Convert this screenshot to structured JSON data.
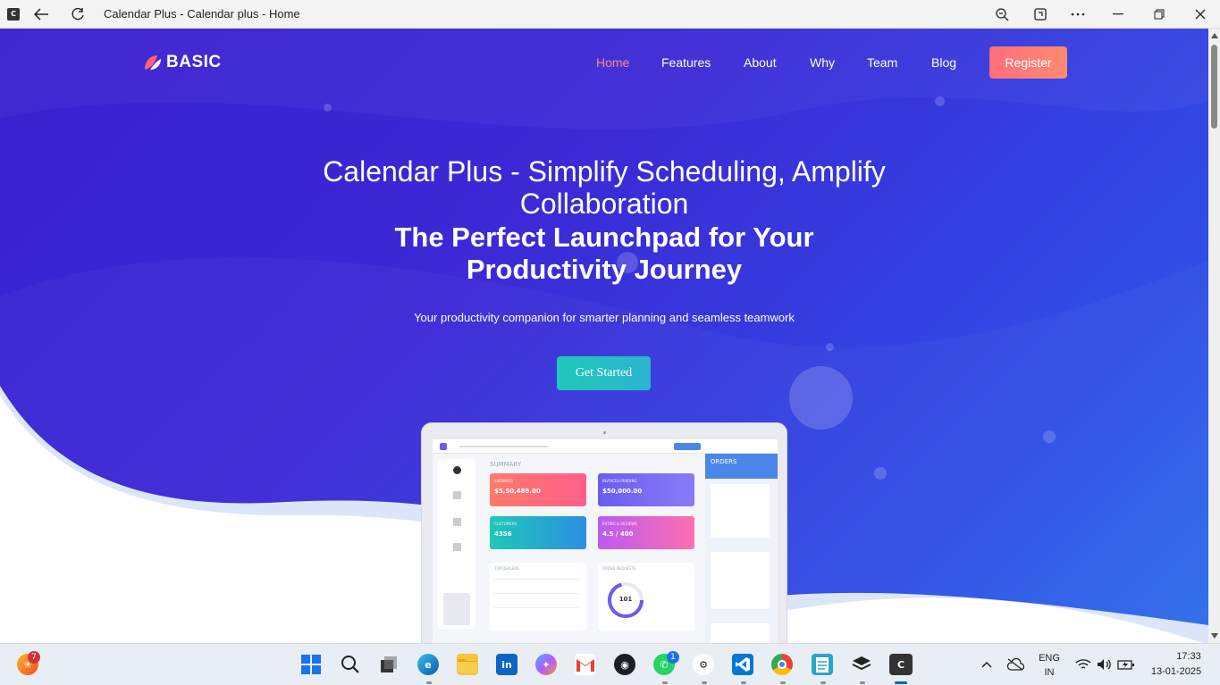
{
  "window": {
    "app_icon_letter": "C",
    "title": "Calendar Plus - Calendar plus - Home"
  },
  "site": {
    "logo_text": "BASIC",
    "nav": [
      {
        "label": "Home",
        "active": true
      },
      {
        "label": "Features",
        "active": false
      },
      {
        "label": "About",
        "active": false
      },
      {
        "label": "Why",
        "active": false
      },
      {
        "label": "Team",
        "active": false
      },
      {
        "label": "Blog",
        "active": false
      }
    ],
    "register_label": "Register"
  },
  "hero": {
    "title": "Calendar Plus - Simplify Scheduling, Amplify Collaboration",
    "headline": "The Perfect Launchpad for Your Productivity Journey",
    "subtitle": "Your productivity companion for smarter planning and seamless teamwork",
    "cta_label": "Get Started"
  },
  "mockup": {
    "summary_label": "SUMMARY",
    "cards": [
      {
        "label": "EARNINGS",
        "value": "$5,50,489.00",
        "color_from": "#ff7a6b",
        "color_to": "#ff5f8a"
      },
      {
        "label": "INVOICES PENDING",
        "value": "$50,000.00",
        "color_from": "#6a5cf0",
        "color_to": "#8a7cf7"
      },
      {
        "label": "CUSTOMERS",
        "value": "4356",
        "color_from": "#1fc8b8",
        "color_to": "#2b8fe0"
      },
      {
        "label": "RATING & REVIEWS",
        "value": "4.5 / 400",
        "color_from": "#b95cf0",
        "color_to": "#ff6fb0"
      }
    ],
    "panels": {
      "left": "TOP DEALERS",
      "right": "ORDER REQUESTS"
    },
    "donut_value": "101",
    "orders_label": "ORDERS"
  },
  "taskbar": {
    "weather_badge": "7",
    "whatsapp_badge": "1",
    "language": "ENG",
    "region": "IN",
    "time": "17:33",
    "date": "13-01-2025"
  }
}
